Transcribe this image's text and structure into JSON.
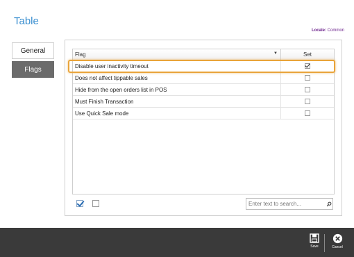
{
  "page": {
    "title": "Table"
  },
  "locale": {
    "label": "Locale:",
    "value": "Common"
  },
  "tabs": [
    {
      "label": "General",
      "active": false
    },
    {
      "label": "Flags",
      "active": true
    }
  ],
  "grid": {
    "columns": {
      "flag": "Flag",
      "set": "Set"
    },
    "rows": [
      {
        "label": "Disable user inactivity timeout",
        "checked": true
      },
      {
        "label": "Does not affect tippable sales",
        "checked": false
      },
      {
        "label": "Hide from the open orders list in POS",
        "checked": false
      },
      {
        "label": "Must Finish Transaction",
        "checked": false
      },
      {
        "label": "Use Quick Sale mode",
        "checked": false
      }
    ]
  },
  "search": {
    "placeholder": "Enter text to search...",
    "icon": "search-icon"
  },
  "footer": {
    "save_label": "Save",
    "cancel_label": "Cancel"
  },
  "colors": {
    "accent": "#3a8fd0",
    "highlight": "#e9a43a",
    "footer_bg": "#3a3a3a",
    "active_tab": "#6b6b6b"
  }
}
